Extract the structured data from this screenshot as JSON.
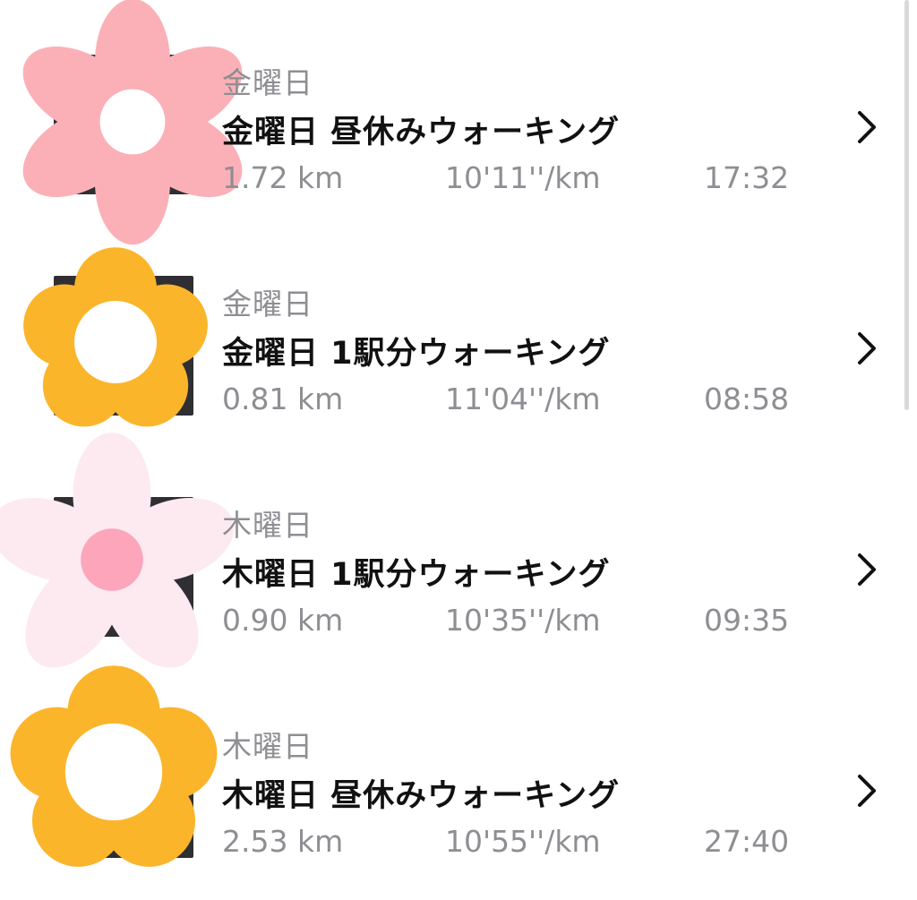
{
  "colors": {
    "flower_pink": "#fbb0b7",
    "flower_orange": "#fbb52b",
    "flower_pale_pink": "#fdeaf1",
    "flower_pale_pink_center": "#fda5bb",
    "text_primary": "#111111",
    "text_secondary": "#8e8e93"
  },
  "workouts": [
    {
      "day": "金曜日",
      "title": "金曜日 昼休みウォーキング",
      "distance": "1.72 km",
      "pace": "10'11''/km",
      "duration": "17:32",
      "icon": "pink-flower-icon"
    },
    {
      "day": "金曜日",
      "title": "金曜日 1駅分ウォーキング",
      "distance": "0.81 km",
      "pace": "11'04''/km",
      "duration": "08:58",
      "icon": "orange-flower-icon"
    },
    {
      "day": "木曜日",
      "title": "木曜日 1駅分ウォーキング",
      "distance": "0.90 km",
      "pace": "10'35''/km",
      "duration": "09:35",
      "icon": "pale-pink-flower-icon"
    },
    {
      "day": "木曜日",
      "title": "木曜日 昼休みウォーキング",
      "distance": "2.53 km",
      "pace": "10'55''/km",
      "duration": "27:40",
      "icon": "orange-flower-icon"
    }
  ]
}
